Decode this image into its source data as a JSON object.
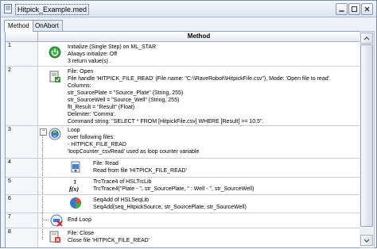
{
  "window": {
    "title": "Hitpick_Example.med"
  },
  "tabs": [
    {
      "label": "Method"
    },
    {
      "label": "OnAbort"
    }
  ],
  "table": {
    "header": "Method"
  },
  "rows": [
    {
      "num": "1",
      "icon": "power-icon",
      "lines": [
        "Initialize (Single Step) on ML_STAR",
        "Always initialize: Off",
        "3 return value(s) ."
      ]
    },
    {
      "num": "2",
      "icon": "file-open-icon",
      "lines": [
        "File: Open",
        "File handle 'HITPICK_FILE_READ' (File name: \"C:\\\\RaveRobot\\\\HitpickFile.csv\"),  Mode: 'Open file to read'.",
        "Columns:",
        "str_SourcePlate = \"Source_Plate\" (String, 255)",
        "str_SourceWell = \"Source_Well\" (String, 255)",
        "flt_Result = \"Result\" (Float)",
        "Delimiter: 'Comma'.",
        "Command string: \"SELECT * FROM [HitpickFile.csv] WHERE [Result] >= 10.5\"."
      ]
    },
    {
      "num": "3",
      "icon": "loop-icon",
      "lines": [
        "Loop",
        "over following files:",
        "- HITPICK_FILE_READ",
        "'loopCounter_csvRead' used as loop counter variable"
      ]
    },
    {
      "num": "4",
      "icon": "file-read-icon",
      "lines": [
        "File: Read",
        "Read from file 'HITPICK_FILE_READ'"
      ]
    },
    {
      "num": "5",
      "icon": "function-icon",
      "lines": [
        "TrcTrace4 of HSLTrcLib",
        "TrcTrace4(\"Plate - \", str_SourcePlate, \" : Well - \", str_SourceWell)"
      ]
    },
    {
      "num": "6",
      "icon": "seqlib-icon",
      "lines": [
        "SeqAdd of HSLSeqLib",
        "SeqAdd(seq_HitpickSource, str_SourcePlate, str_SourceWell)"
      ]
    },
    {
      "num": "7",
      "icon": "end-loop-icon",
      "lines": [
        "End Loop"
      ]
    },
    {
      "num": "8",
      "icon": "file-close-icon",
      "lines": [
        "File: Close",
        "Close file 'HITPICK_FILE_READ'"
      ]
    }
  ]
}
